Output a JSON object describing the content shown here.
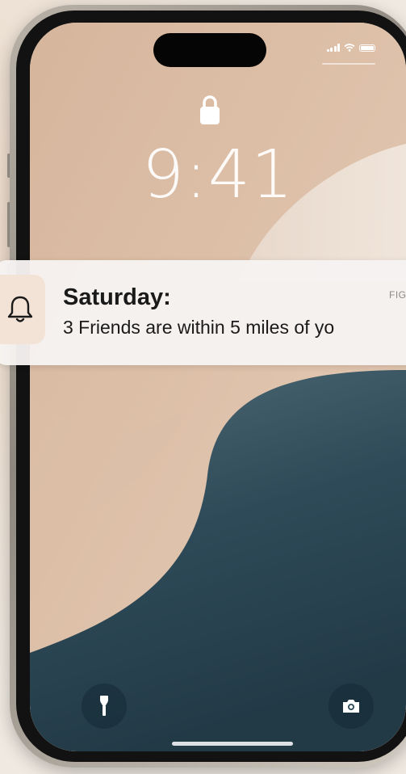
{
  "lock_screen": {
    "time": "9:41",
    "lock_icon": "lock-icon"
  },
  "status_bar": {
    "icons": [
      "signal-icon",
      "wifi-icon",
      "battery-icon"
    ]
  },
  "notification": {
    "icon": "bell-icon",
    "title": "Saturday:",
    "source": "FIG",
    "body": "3 Friends are within 5 miles of yo"
  },
  "quick_actions": {
    "left": "flashlight-icon",
    "right": "camera-icon"
  },
  "colors": {
    "wallpaper_peach": "#e2cdbb",
    "wallpaper_teal": "#2e4a58",
    "notification_bg": "#f6f3f1",
    "icon_box_bg": "#f3e3d6"
  }
}
